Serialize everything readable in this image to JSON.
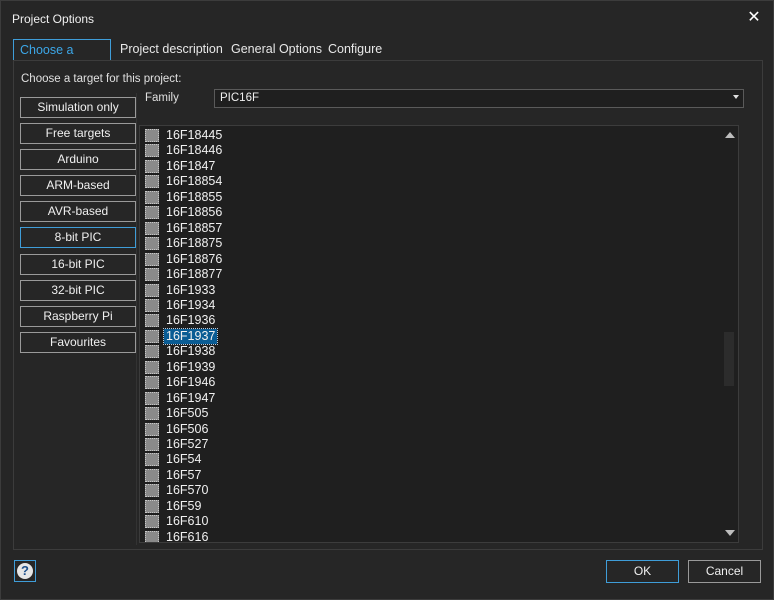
{
  "window": {
    "title": "Project Options"
  },
  "tabs": [
    {
      "label": "Choose a Target"
    },
    {
      "label": "Project description"
    },
    {
      "label": "General Options"
    },
    {
      "label": "Configure"
    }
  ],
  "prompt": "Choose a target for this project:",
  "categories": [
    {
      "label": "Simulation only"
    },
    {
      "label": "Free targets"
    },
    {
      "label": "Arduino"
    },
    {
      "label": "ARM-based"
    },
    {
      "label": "AVR-based"
    },
    {
      "label": "8-bit PIC"
    },
    {
      "label": "16-bit PIC"
    },
    {
      "label": "32-bit PIC"
    },
    {
      "label": "Raspberry Pi"
    },
    {
      "label": "Favourites"
    }
  ],
  "selected_category": "8-bit PIC",
  "family": {
    "label": "Family",
    "value": "PIC16F"
  },
  "devices": [
    "16F18445",
    "16F18446",
    "16F1847",
    "16F18854",
    "16F18855",
    "16F18856",
    "16F18857",
    "16F18875",
    "16F18876",
    "16F18877",
    "16F1933",
    "16F1934",
    "16F1936",
    "16F1937",
    "16F1938",
    "16F1939",
    "16F1946",
    "16F1947",
    "16F505",
    "16F506",
    "16F527",
    "16F54",
    "16F57",
    "16F570",
    "16F59",
    "16F610",
    "16F616"
  ],
  "selected_device": "16F1937",
  "buttons": {
    "ok": "OK",
    "cancel": "Cancel"
  },
  "colors": {
    "accent": "#3f9dd8",
    "selection": "#0a5c94",
    "background": "#262626"
  }
}
